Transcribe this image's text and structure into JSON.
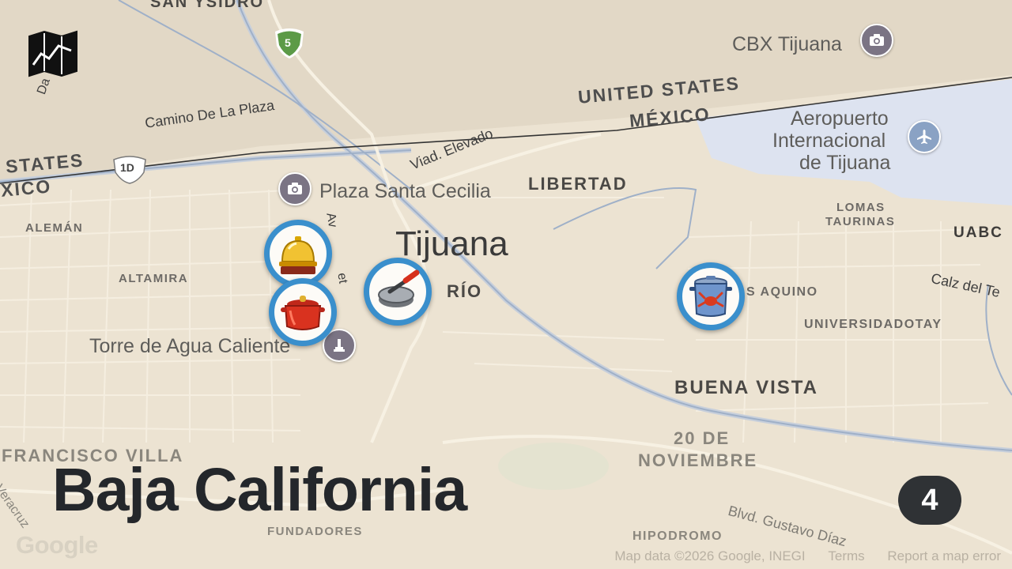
{
  "map": {
    "city_label": "Tijuana",
    "country_labels": {
      "us_main": "UNITED STATES",
      "mx_main": "MÉXICO",
      "us_left": "STATES",
      "mx_left": "XICO"
    },
    "neighborhoods": [
      "LIBERTAD",
      "ALEMÁN",
      "ALTAMIRA",
      "RÍO",
      "LOMAS",
      "TAURINAS",
      "UABC",
      "S AQUINO",
      "UNIVERSIDADOTAY",
      "BUENA VISTA",
      "20 DE",
      "NOVIEMBRE",
      "FRANCISCO VILLA",
      "FUNDADORES",
      "HIPODROMO",
      "SAN YSIDRO"
    ],
    "roads": [
      "Camino De La Plaza",
      "Viad. Elevado",
      "Calz del Te",
      "Blvd. Gustavo Díaz",
      "Veracruz",
      "Da",
      "Av",
      "et"
    ],
    "shields": {
      "interstate": "5",
      "highway": "1D"
    },
    "pois": [
      {
        "label": "CBX Tijuana",
        "icon": "camera-icon"
      },
      {
        "label": "Aeropuerto Internacional de Tijuana",
        "line1": "Aeropuerto",
        "line2": "Internacional",
        "line3": "de Tijuana",
        "icon": "airplane-icon"
      },
      {
        "label": "Plaza Santa Cecilia",
        "icon": "camera-icon"
      },
      {
        "label": "Torre de Agua Caliente",
        "icon": "monument-icon"
      }
    ],
    "markers": [
      {
        "icon": "service-bell-icon"
      },
      {
        "icon": "cooking-pot-icon"
      },
      {
        "icon": "tortilla-press-icon"
      },
      {
        "icon": "crab-stockpot-icon"
      }
    ],
    "colors": {
      "land": "#ece3d2",
      "airport": "#dde3f0",
      "marker_ring": "#3a8fcc",
      "badge": "#2f3235",
      "road": "#f7f1e3"
    }
  },
  "overlay": {
    "region_title": "Baja California",
    "marker_count": "4",
    "logo": "map-logo-icon"
  },
  "attribution": {
    "google": "Google",
    "map_data": "Map data ©2026 Google, INEGI",
    "terms": "Terms",
    "report": "Report a map error"
  }
}
